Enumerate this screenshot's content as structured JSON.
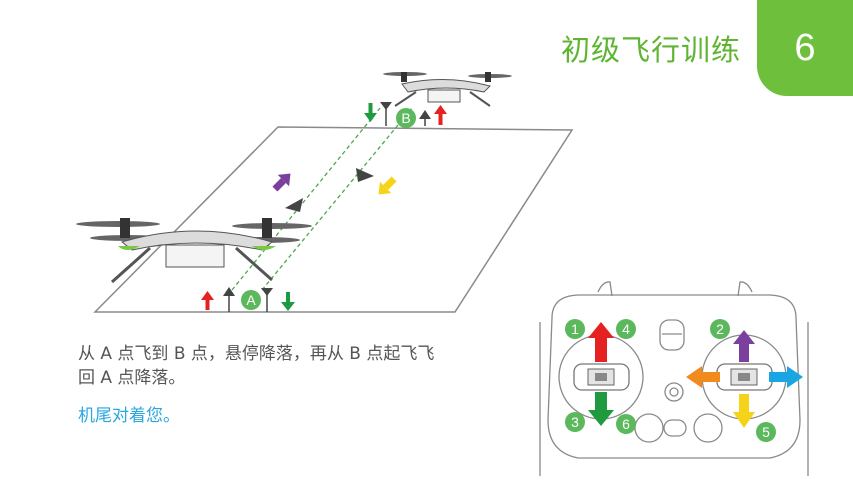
{
  "header": {
    "title": "初级飞行训练",
    "chapter_number": "6"
  },
  "instructions": {
    "line1": "从 A 点飞到 B 点，悬停降落，再从 B 点起飞飞",
    "line2": "回 A 点降落。",
    "tip": "机尾对着您。"
  },
  "diagram": {
    "point_a": "A",
    "point_b": "B"
  },
  "controller": {
    "stick_labels": [
      "1",
      "2",
      "3",
      "4",
      "5",
      "6"
    ]
  },
  "colors": {
    "brand_green": "#6dbf3c",
    "marker_green": "#5cb85c",
    "arrow_red": "#e52222",
    "arrow_green": "#1f9a3f",
    "arrow_purple": "#7b3f9e",
    "arrow_yellow": "#f5d318",
    "arrow_orange": "#f28b1e",
    "arrow_blue": "#19a6e3",
    "tip_blue": "#2aa7df"
  }
}
